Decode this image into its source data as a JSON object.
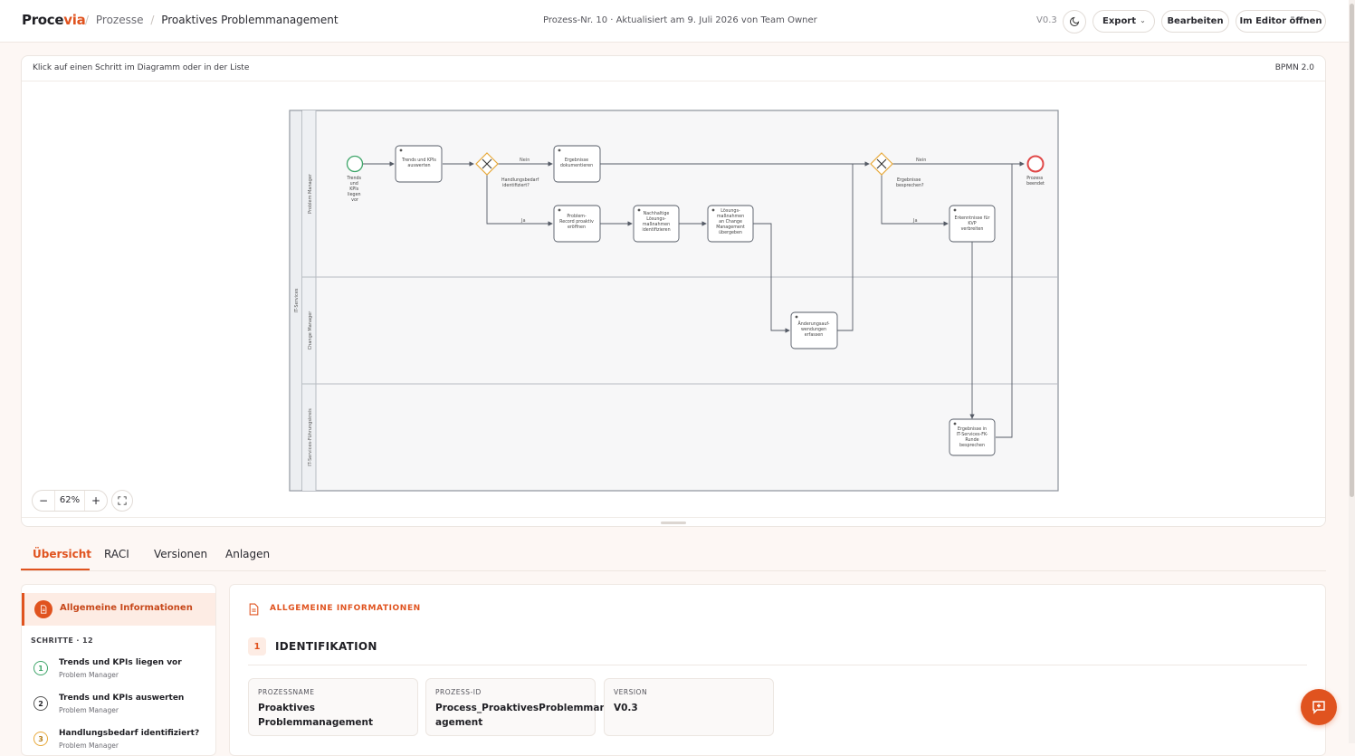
{
  "header": {
    "logo_main": "Proce",
    "logo_accent": "via",
    "breadcrumb_root": "Prozesse",
    "breadcrumb_current": "Proaktives Problemmanagement",
    "meta": "Prozess-Nr. 10 · Aktualisiert am 9. Juli 2026 von Team Owner",
    "version": "V0.3",
    "export_label": "Export",
    "edit_label": "Bearbeiten",
    "open_editor_label": "Im Editor öffnen"
  },
  "diagram": {
    "hint": "Klick auf einen Schritt im Diagramm oder in der Liste",
    "notation": "BPMN 2.0",
    "zoom": "62%",
    "pool": "IT-Services",
    "lanes": [
      "Problem Manager",
      "Change Manager",
      "IT-Services-Führungskreis"
    ],
    "start_event": [
      "Trends",
      "und",
      "KPIs",
      "liegen",
      "vor"
    ],
    "end_event": [
      "Prozess",
      "beendet"
    ],
    "tasks": {
      "t1": [
        "Trends und KPIs",
        "auswerten"
      ],
      "t2": [
        "Ergebnisse",
        "dokumentieren"
      ],
      "t3": [
        "Problem-",
        "Record proaktiv",
        "eröffnen"
      ],
      "t4": [
        "Nachhaltige",
        "Lösungs-",
        "maßnahmen",
        "identifizieren"
      ],
      "t5": [
        "Lösungs-",
        "maßnahmen",
        "an Change",
        "Management",
        "übergeben"
      ],
      "t6": [
        "Änderungsauf-",
        "wendungen",
        "erfassen"
      ],
      "t7": [
        "Erkenntnisse für",
        "KVP",
        "verbreiten"
      ],
      "t8": [
        "Ergebnisse in",
        "IT-Services-FK-",
        "Runde",
        "besprechen"
      ]
    },
    "gateways": {
      "g1": [
        "Handlungsbedarf",
        "identifiziert?"
      ],
      "g2": [
        "Ergebnisse",
        "besprechen?"
      ]
    },
    "flow_labels": {
      "no": "Nein",
      "yes": "Ja"
    }
  },
  "tabs": [
    "Übersicht",
    "RACI",
    "Versionen",
    "Anlagen"
  ],
  "left_panel": {
    "active_label": "Allgemeine Informationen",
    "steps_title": "SCHRITTE · 12",
    "steps": [
      {
        "num": "1",
        "title": "Trends und KPIs liegen vor",
        "role": "Problem Manager"
      },
      {
        "num": "2",
        "title": "Trends und KPIs auswerten",
        "role": "Problem Manager"
      },
      {
        "num": "3",
        "title": "Handlungsbedarf identifiziert?",
        "role": "Problem Manager"
      }
    ]
  },
  "right_panel": {
    "header": "ALLGEMEINE INFORMATIONEN",
    "section_num": "1",
    "section_title": "IDENTIFIKATION",
    "fields": [
      {
        "label": "PROZESSNAME",
        "value": "Proaktives Problemmanagement"
      },
      {
        "label": "PROZESS-ID",
        "value": "Process_ProaktivesProblemman agement"
      },
      {
        "label": "VERSION",
        "value": "V0.3"
      }
    ]
  },
  "colors": {
    "accent": "#e0531f",
    "start": "#3fa66a",
    "end": "#e04848",
    "gateway": "#e8a93a"
  }
}
